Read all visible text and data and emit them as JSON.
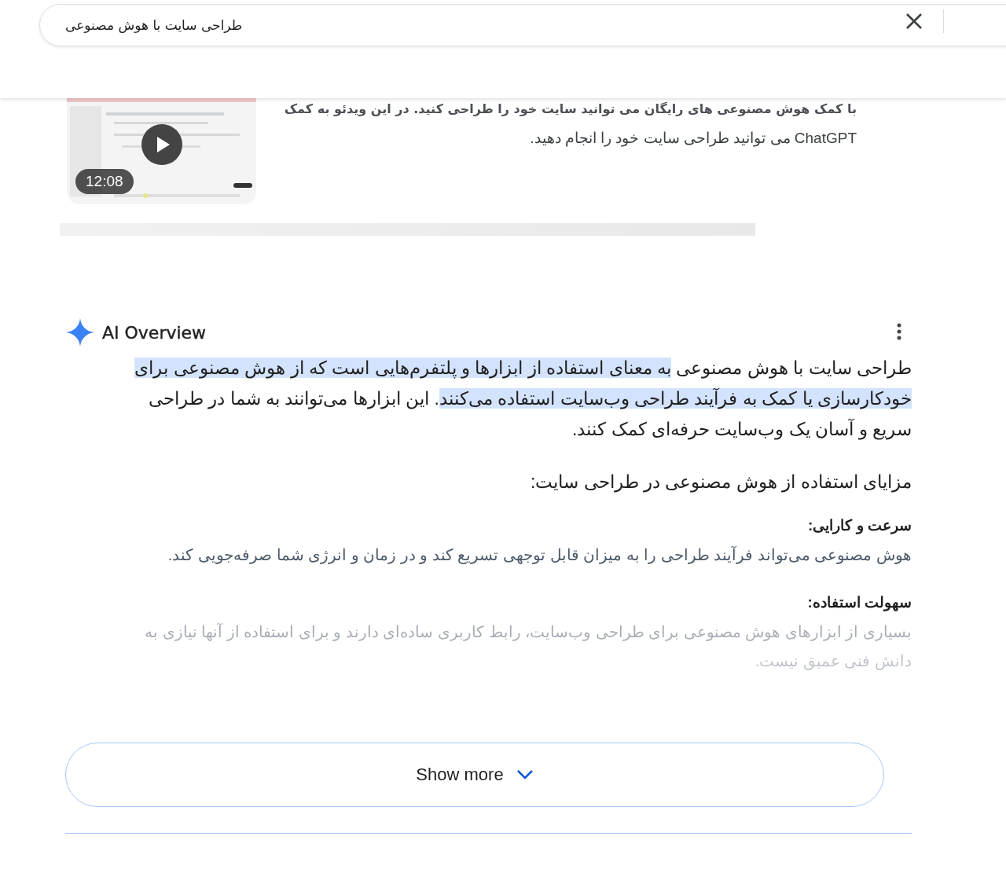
{
  "search": {
    "value": "طراحی سایت با هوش مصنوعی"
  },
  "video": {
    "duration": "12:08",
    "description": [
      "با کمک هوش مصنوعی های رایگان می توانید سایت خود را طراحی کنید. در این ویدئو به کمک",
      "ChatGPT می توانید طراحی سایت خود را انجام دهید."
    ]
  },
  "ai_overview": {
    "title": "AI Overview",
    "summary": [
      {
        "text": "طراحی سایت با هوش مصنوعی ",
        "highlighted": false
      },
      {
        "text": "به معنای استفاده از ابزارها و پلتفرم‌هایی است که از هوش مصنوعی برای خودکارسازی یا کمک به فرآیند طراحی وب‌سایت استفاده می‌کنند",
        "highlighted": true
      },
      {
        "text": ". این ابزارها می‌توانند به شما در طراحی سریع و آسان یک وب‌سایت حرفه‌ای کمک کنند.",
        "highlighted": false
      }
    ],
    "heading": "مزایای استفاده از هوش مصنوعی در طراحی سایت:",
    "sections": [
      {
        "title": "سرعت و کارایی:",
        "body": "هوش مصنوعی می‌تواند فرآیند طراحی را به میزان قابل توجهی تسریع کند و در زمان و انرژی شما صرفه‌جویی کند.",
        "faded": false
      },
      {
        "title": "سهولت استفاده:",
        "body": "بسیاری از ابزارهای هوش مصنوعی برای طراحی وب‌سایت، رابط کاربری ساده‌ای دارند و برای استفاده از آنها نیازی به دانش فنی عمیق نیست.",
        "faded": true
      }
    ],
    "show_more": "Show more"
  }
}
